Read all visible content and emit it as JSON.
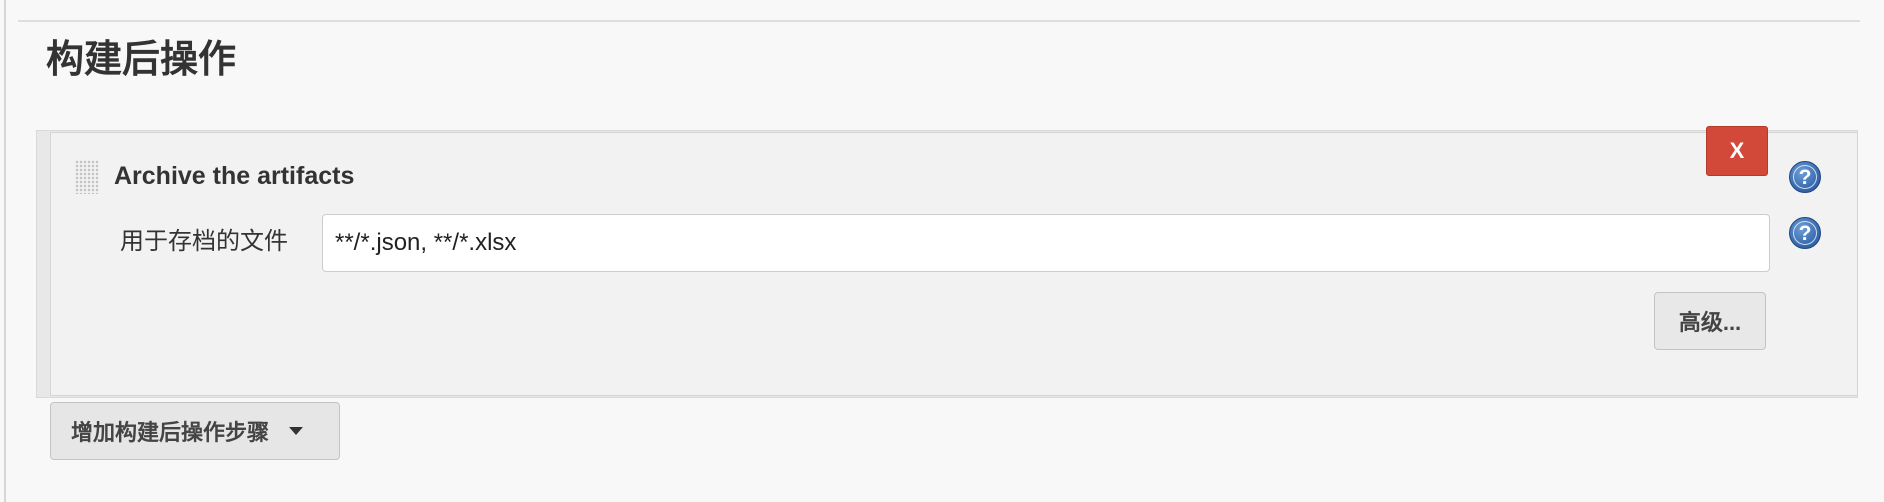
{
  "section": {
    "title": "构建后操作"
  },
  "step": {
    "title": "Archive the artifacts",
    "delete_label": "X",
    "help_icon": "question-circle-icon",
    "handle_icon": "drag-handle-icon",
    "field": {
      "label": "用于存档的文件",
      "value": "**/*.json, **/*.xlsx"
    },
    "advanced_label": "高级..."
  },
  "add_step": {
    "label": "增加构建后操作步骤",
    "icon": "caret-down-icon"
  },
  "colors": {
    "delete_red": "#d24939",
    "help_blue": "#3d6fb4",
    "panel_bg": "#f2f2f2",
    "page_bg": "#f8f8f8"
  }
}
